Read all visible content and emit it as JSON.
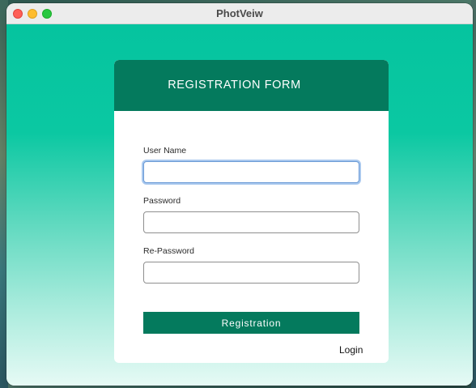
{
  "window": {
    "title": "PhotVeiw"
  },
  "form": {
    "title": "REGISTRATION FORM",
    "fields": [
      {
        "label": "User Name",
        "value": "",
        "focused": true
      },
      {
        "label": "Password",
        "value": ""
      },
      {
        "label": "Re-Password",
        "value": ""
      }
    ],
    "submit_label": "Registration",
    "login_label": "Login"
  },
  "colors": {
    "header": "#047a5d",
    "button": "#047a5d",
    "background_top": "#05c49f",
    "background_bottom": "#e6faf5"
  }
}
